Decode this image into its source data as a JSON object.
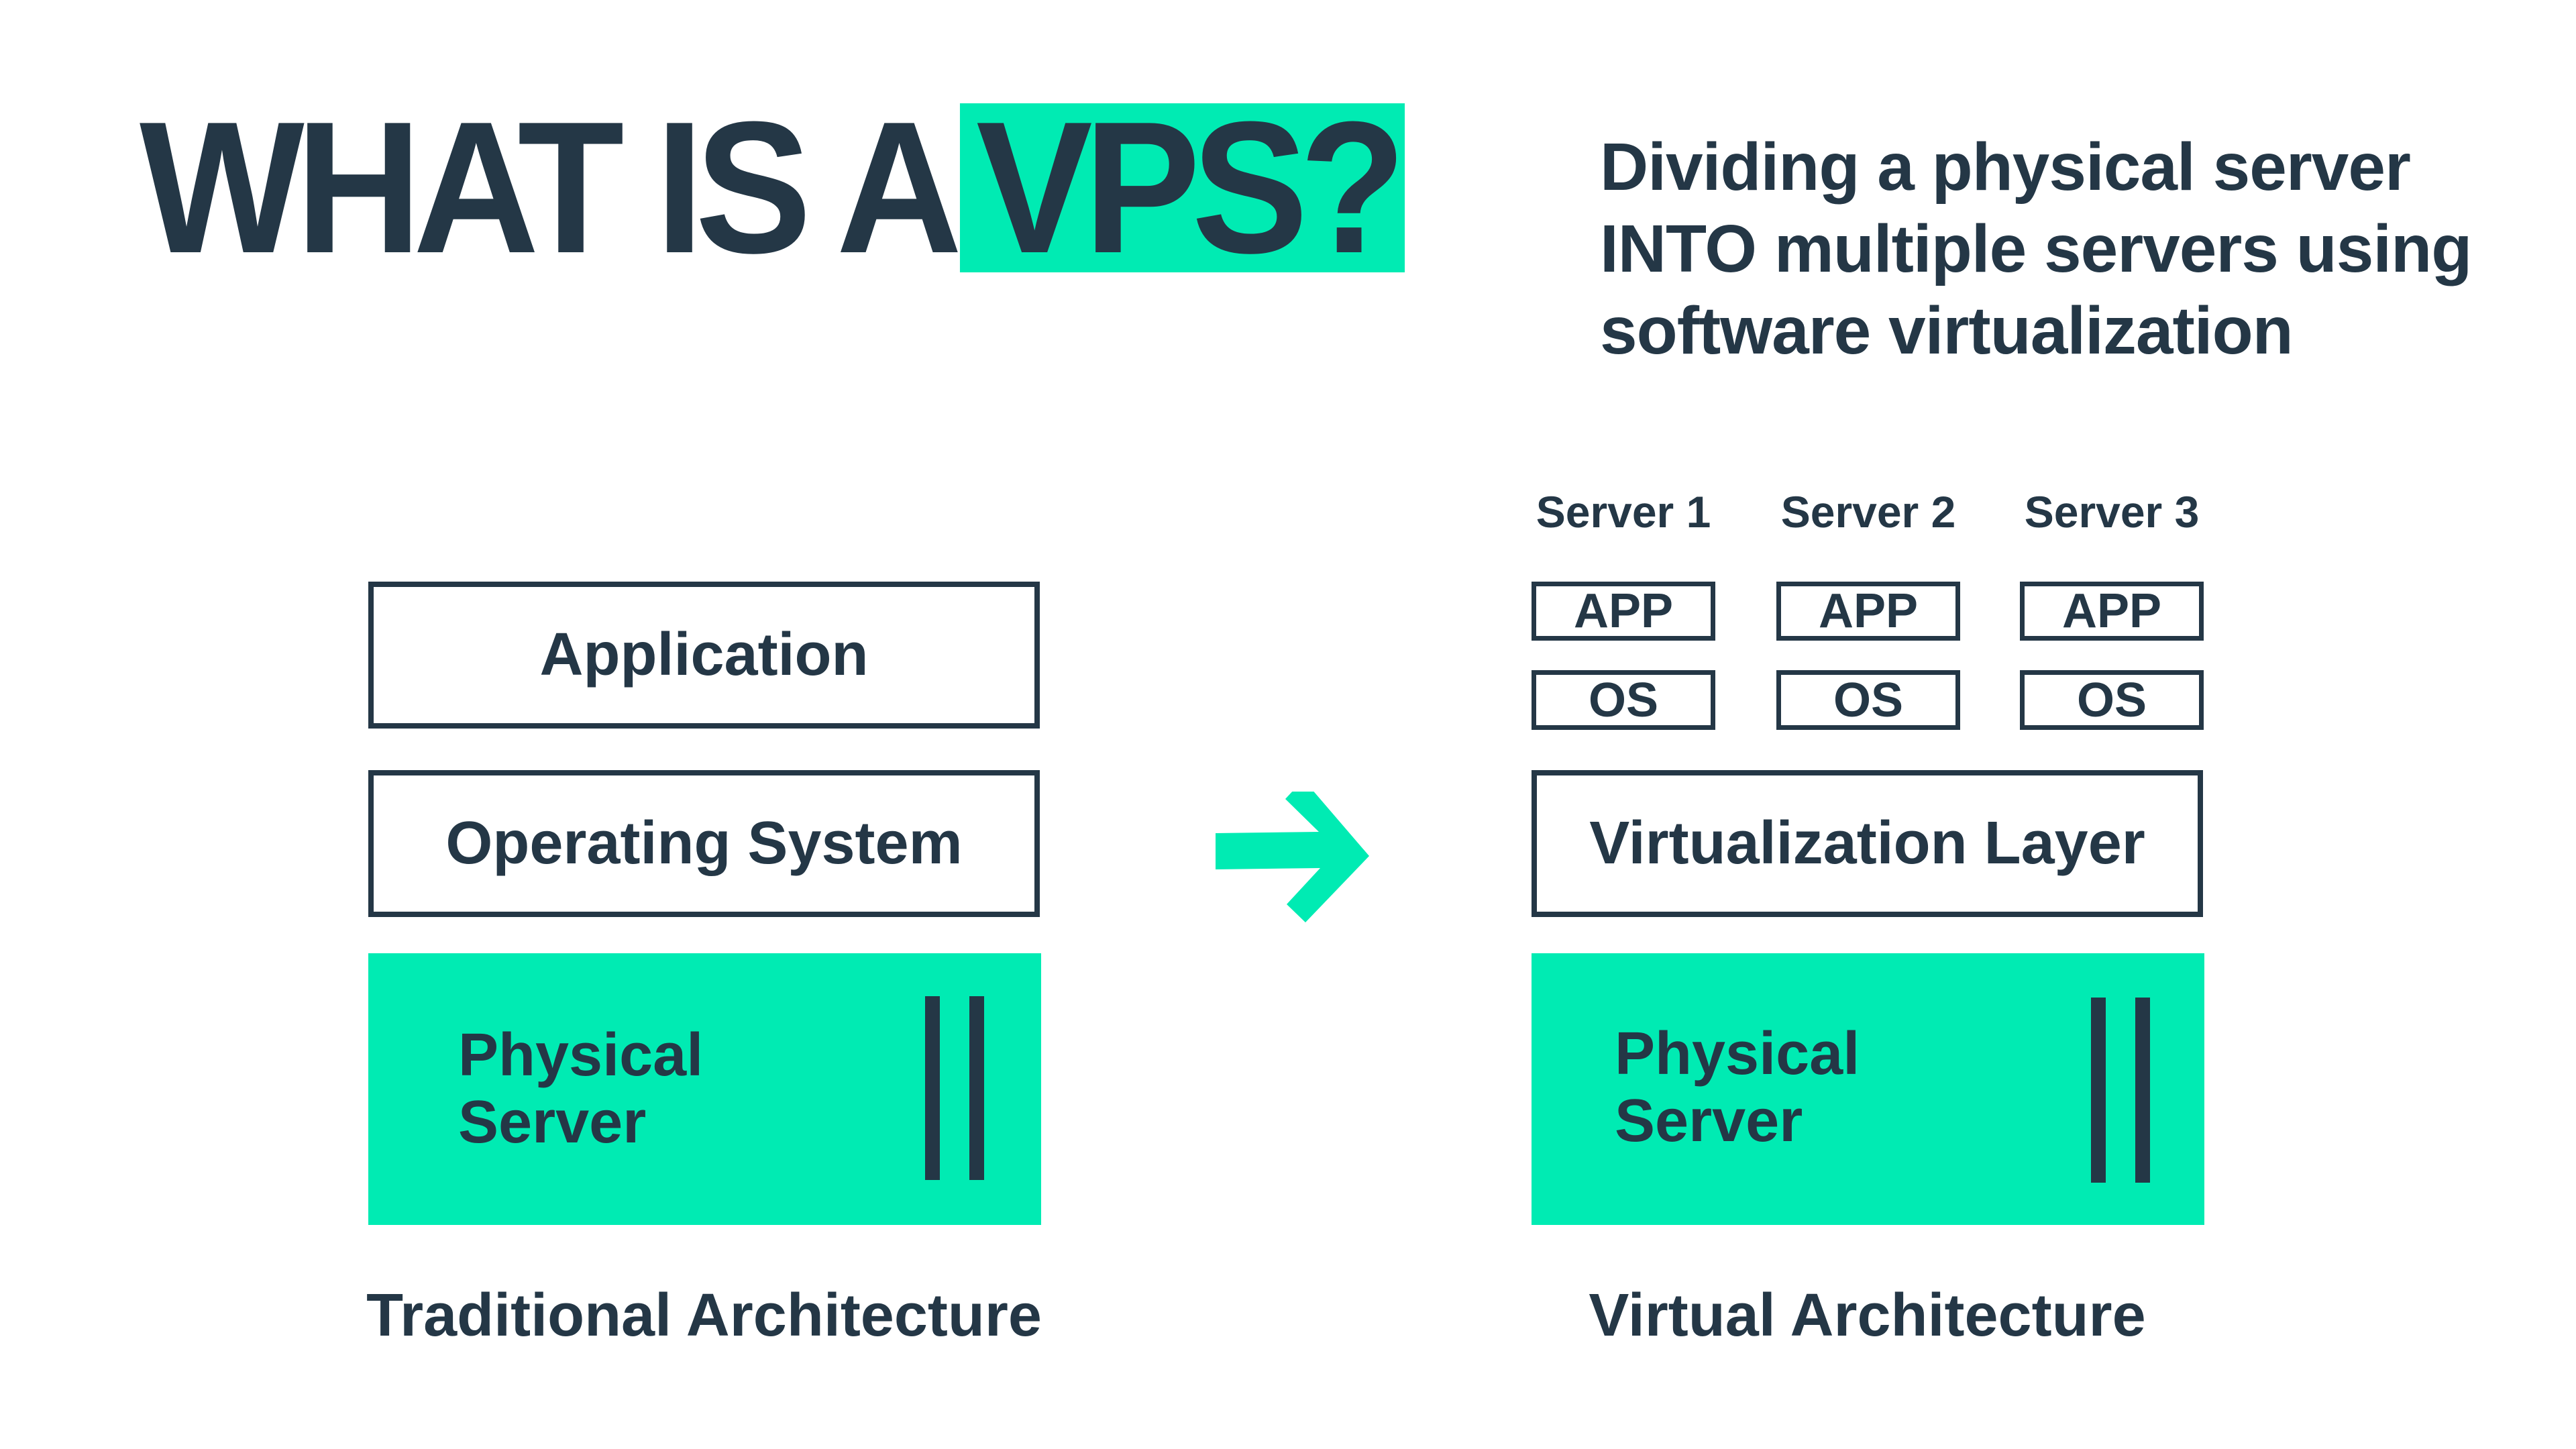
{
  "title": {
    "prefix": "WHAT IS A",
    "highlight": "VPS?"
  },
  "subtitle": {
    "lines": [
      "Dividing a physical server",
      "INTO multiple servers using",
      "software virtualization"
    ]
  },
  "traditional": {
    "layers": {
      "application": "Application",
      "operating_system": "Operating System"
    },
    "physical_server": [
      "Physical",
      "Server"
    ],
    "caption": "Traditional Architecture"
  },
  "arrow": {
    "icon": "arrow-right-icon"
  },
  "virtual": {
    "servers": [
      {
        "label": "Server 1",
        "app": "APP",
        "os": "OS"
      },
      {
        "label": "Server 2",
        "app": "APP",
        "os": "OS"
      },
      {
        "label": "Server 3",
        "app": "APP",
        "os": "OS"
      }
    ],
    "virtualization_layer": "Virtualization Layer",
    "physical_server": [
      "Physical",
      "Server"
    ],
    "caption": "Virtual Architecture"
  },
  "colors": {
    "accent": "#00ebb3",
    "text": "#243746",
    "background": "#ffffff"
  }
}
